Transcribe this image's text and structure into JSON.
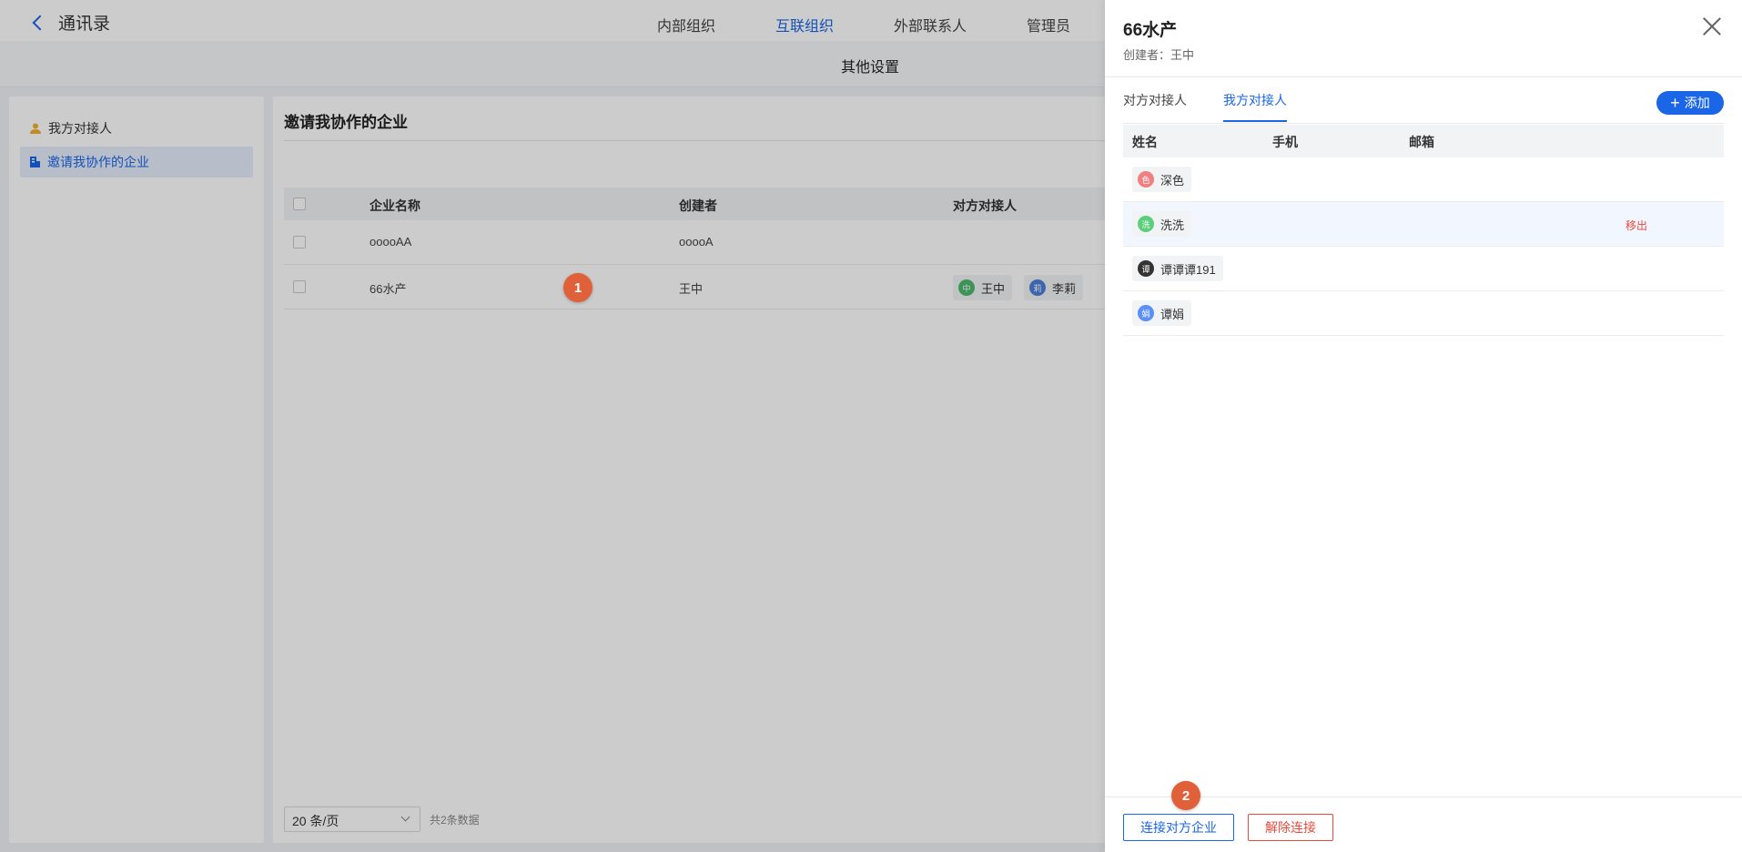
{
  "header": {
    "back_label": "通讯录",
    "nav": [
      "内部组织",
      "互联组织",
      "外部联系人",
      "管理员"
    ],
    "active_nav": "互联组织",
    "subtitle": "其他设置"
  },
  "sidebar": {
    "items": [
      {
        "label": "我方对接人",
        "icon": "user-icon"
      },
      {
        "label": "邀请我协作的企业",
        "icon": "building-icon"
      }
    ]
  },
  "main": {
    "title": "邀请我协作的企业",
    "columns": [
      "企业名称",
      "创建者",
      "对方对接人"
    ],
    "rows": [
      {
        "name": "ooooAA",
        "creator": "ooooA",
        "contacts": []
      },
      {
        "name": "66水产",
        "creator": "王中",
        "contacts": [
          {
            "name": "王中",
            "avatar": "中",
            "color": "#4cba6c"
          },
          {
            "name": "李莉",
            "avatar": "莉",
            "color": "#4a7fd8"
          }
        ]
      }
    ],
    "pager": {
      "page_size": "20 条/页",
      "total": "共2条数据"
    }
  },
  "drawer": {
    "title": "66水产",
    "creator": "创建者：王中",
    "tabs": [
      "对方对接人",
      "我方对接人"
    ],
    "active_tab": "我方对接人",
    "add_label": "添加",
    "columns": [
      "姓名",
      "手机",
      "邮箱"
    ],
    "rows": [
      {
        "name": "深色",
        "avatar": "色",
        "color": "#f08080"
      },
      {
        "name": "洗洗",
        "avatar": "洗",
        "color": "#5ccf7c",
        "remove": "移出"
      },
      {
        "name": "谭谭谭191",
        "avatar": "谭",
        "color": "#333333"
      },
      {
        "name": "谭娟",
        "avatar": "娟",
        "color": "#5b8ff9"
      }
    ],
    "connect_label": "连接对方企业",
    "disconnect_label": "解除连接"
  },
  "annotations": [
    "1",
    "2"
  ],
  "colors": {
    "accent": "#1a66e6",
    "danger": "#e84a3c",
    "badge": "#e0603a"
  }
}
